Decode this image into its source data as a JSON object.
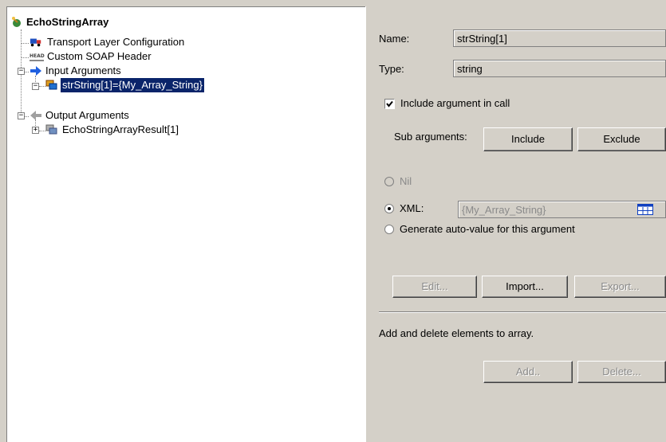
{
  "tree": {
    "root": "EchoStringArray",
    "transport": "Transport Layer Configuration",
    "soap_header": "Custom SOAP Header",
    "input_args": "Input Arguments",
    "selected_arg": "strString[1]={My_Array_String}",
    "output_args": "Output Arguments",
    "result": "EchoStringArrayResult[1]",
    "head_icon_text": "HEAD",
    "selection_color": "#0a246a"
  },
  "props": {
    "name_label": "Name:",
    "name_value": "strString[1]",
    "type_label": "Type:",
    "type_value": "string",
    "include_label": "Include argument in call",
    "include_checked": true,
    "sub_args_label": "Sub arguments:",
    "include_btn": "Include",
    "exclude_btn": "Exclude",
    "nil_label": "Nil",
    "xml_label": "XML:",
    "xml_value": "{My_Array_String}",
    "auto_label": "Generate auto-value for this argument",
    "edit_btn": "Edit...",
    "import_btn": "Import...",
    "export_btn": "Export...",
    "array_hint": "Add and delete elements to array.",
    "add_btn": "Add..",
    "delete_btn": "Delete..."
  }
}
